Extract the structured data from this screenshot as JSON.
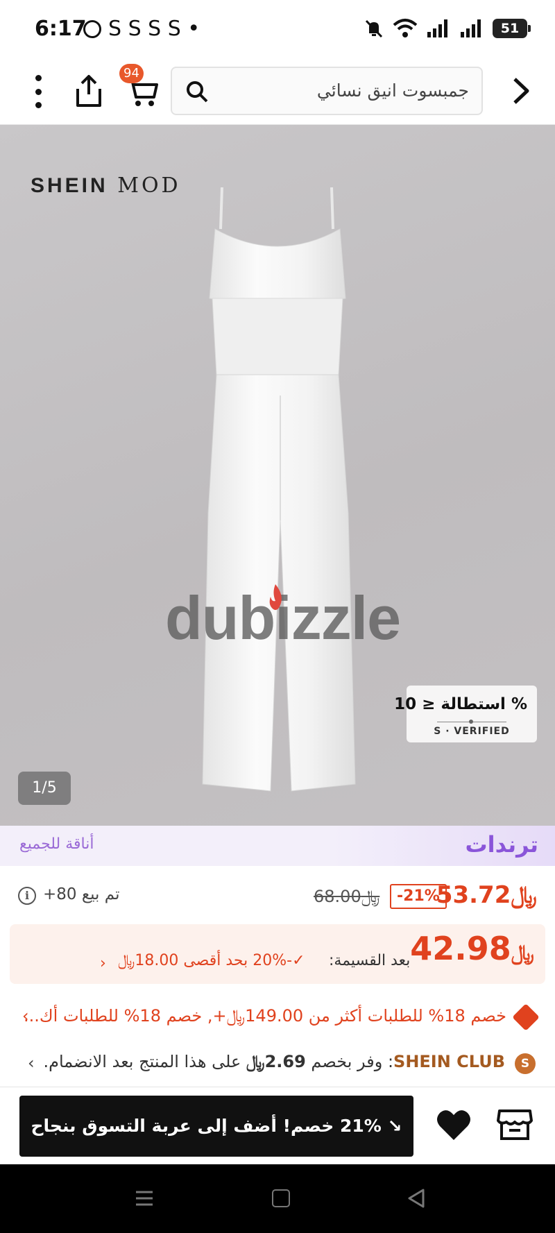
{
  "status_bar": {
    "time": "6:17",
    "notifications": "S S S S •",
    "battery": "51"
  },
  "header": {
    "cart_count": "94",
    "search_query": "جمبسوت انيق نسائي"
  },
  "product_image": {
    "brand": "SHEIN",
    "brand_suffix": "MOD",
    "watermark": "dubizzle",
    "stretch_badge": "% استطالة ≤ 10",
    "stretch_verified": "S · VERIFIED",
    "page_counter": "1/5"
  },
  "trends": {
    "title": "ترندات",
    "subtitle": "أناقة للجميع"
  },
  "price": {
    "current": "53.72",
    "currency_symbol": "﷼",
    "discount": "-21%",
    "original": "68.00",
    "sold": "تم بيع 80+"
  },
  "installment": {
    "price": "42.98",
    "label": "بعد القسيمة:",
    "detail": "✓-20% بحد أقصى 18.00﷼",
    "chevron": "›"
  },
  "promo": {
    "text": "خصم 18% للطلبات أكثر من 149.00﷼+,  خصم 18% للطلبات أك...",
    "chevron": "‹"
  },
  "club": {
    "icon_letter": "S",
    "name": "SHEIN CLUB",
    "text_before": ": وفر بخصم ",
    "amount": "2.69﷼",
    "text_after": " على هذا المنتج بعد الانضمام.",
    "chevron": "‹"
  },
  "action_bar": {
    "add_to_cart": "↘ 21% خصم! أضف إلى عربة التسوق بنجاح"
  },
  "colors": {
    "accent": "#e0421e",
    "trends_purple": "#8a55d9",
    "club_brown": "#a45a20",
    "button_dark": "#111111"
  }
}
